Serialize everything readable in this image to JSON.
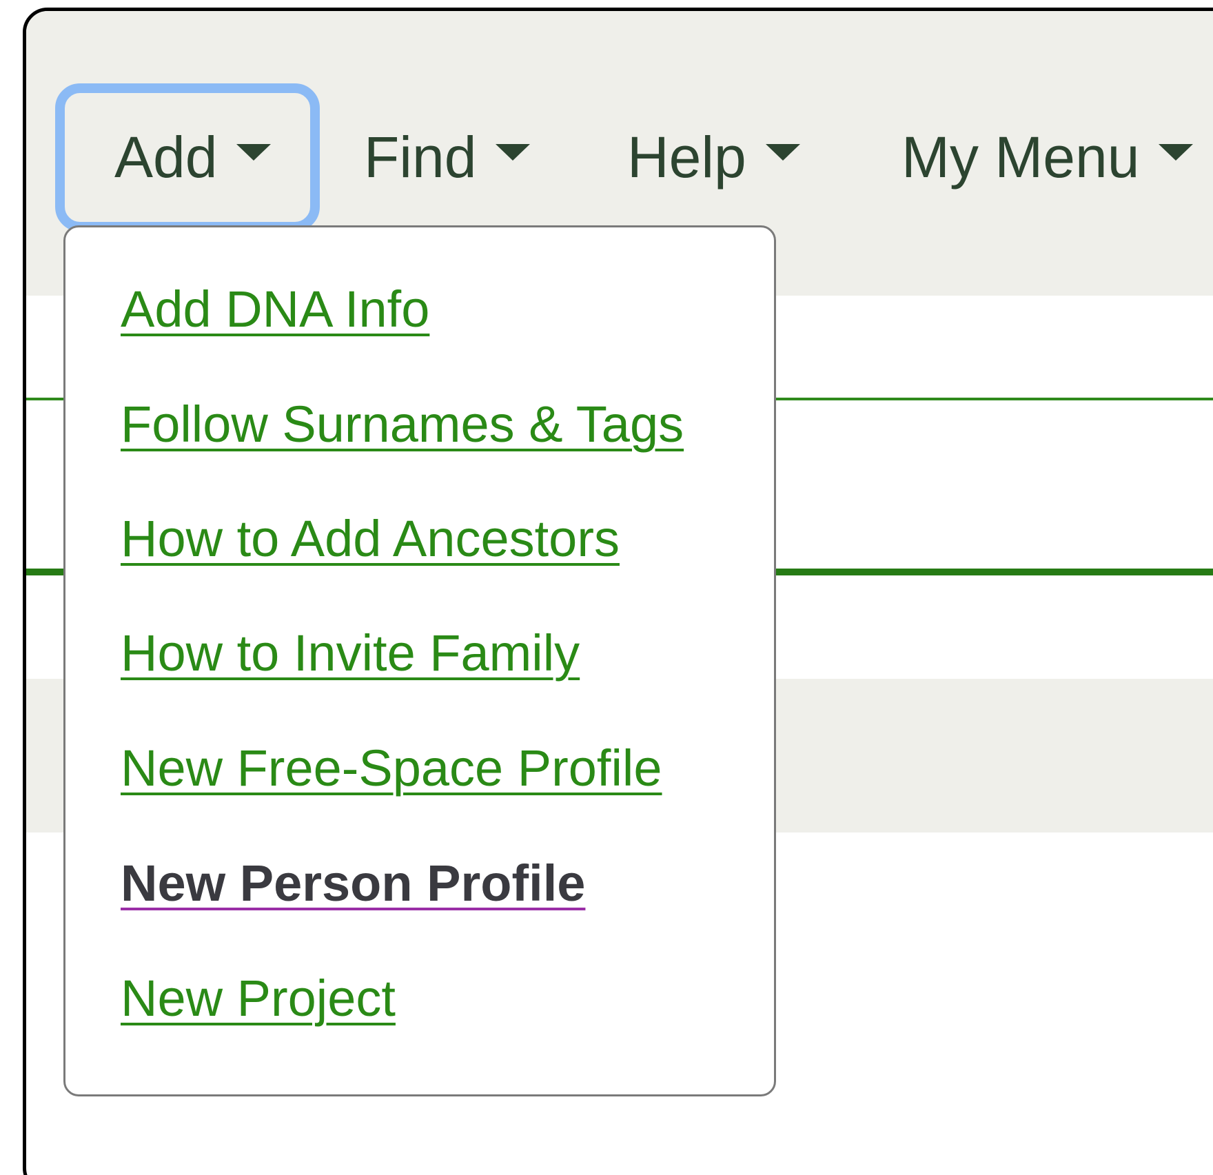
{
  "nav": {
    "items": [
      {
        "label": "Add"
      },
      {
        "label": "Find"
      },
      {
        "label": "Help"
      },
      {
        "label": "My Menu"
      }
    ]
  },
  "dropdown": {
    "items": [
      {
        "label": "Add DNA Info"
      },
      {
        "label": "Follow Surnames & Tags"
      },
      {
        "label": "How to Add Ancestors"
      },
      {
        "label": "How to Invite Family"
      },
      {
        "label": "New Free-Space Profile"
      },
      {
        "label": "New Person Profile"
      },
      {
        "label": "New Project"
      }
    ]
  },
  "colors": {
    "link": "#2a8a16",
    "menu_text": "#2c4430",
    "focus_ring": "#8bbaf5",
    "topbar_bg": "#efefea",
    "visited_underline": "#9a2ea6"
  }
}
